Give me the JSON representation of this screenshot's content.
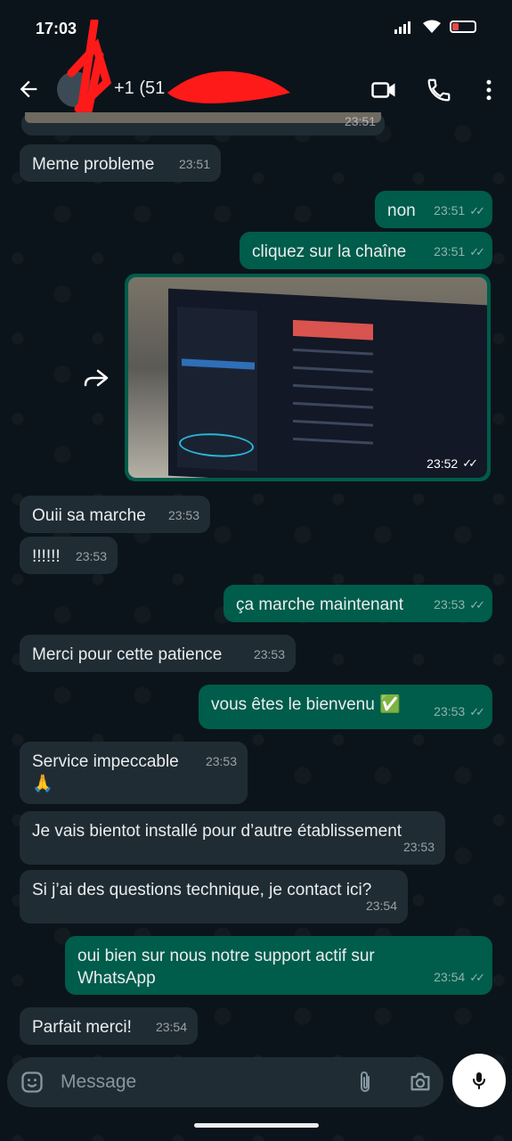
{
  "status_bar": {
    "time": "17:03"
  },
  "header": {
    "contact_name": "+1 (51"
  },
  "top_image_time": "23:51",
  "messages": [
    {
      "dir": "in",
      "text": "Meme probleme",
      "time": "23:51"
    },
    {
      "dir": "out",
      "text": "non",
      "time": "23:51"
    },
    {
      "dir": "out",
      "text": "cliquez sur la chaîne",
      "time": "23:51"
    },
    {
      "dir": "in",
      "text": "Ouii sa marche",
      "time": "23:53"
    },
    {
      "dir": "in",
      "text": "!!!!!!",
      "time": "23:53"
    },
    {
      "dir": "out",
      "text": "ça marche maintenant",
      "time": "23:53"
    },
    {
      "dir": "in",
      "text": "Merci pour cette patience",
      "time": "23:53"
    },
    {
      "dir": "out",
      "text": "vous êtes le bienvenu ✅",
      "time": "23:53"
    },
    {
      "dir": "in",
      "text": "Service impeccable",
      "time": "23:53",
      "extra": "🙏"
    },
    {
      "dir": "in",
      "text": "Je vais bientot installé pour d’autre établissement",
      "time": "23:53"
    },
    {
      "dir": "in",
      "text": "Si j’ai des questions technique, je contact ici?",
      "time": "23:54"
    },
    {
      "dir": "out",
      "text": "oui bien sur nous notre support actif sur WhatsApp",
      "time": "23:54"
    },
    {
      "dir": "in",
      "text": "Parfait merci!",
      "time": "23:54"
    }
  ],
  "image_message": {
    "time": "23:52"
  },
  "composer": {
    "placeholder": "Message"
  },
  "colors": {
    "incoming": "#202c33",
    "outgoing": "#005c4b",
    "background": "#0b141a",
    "ticks": "#8696a0"
  }
}
